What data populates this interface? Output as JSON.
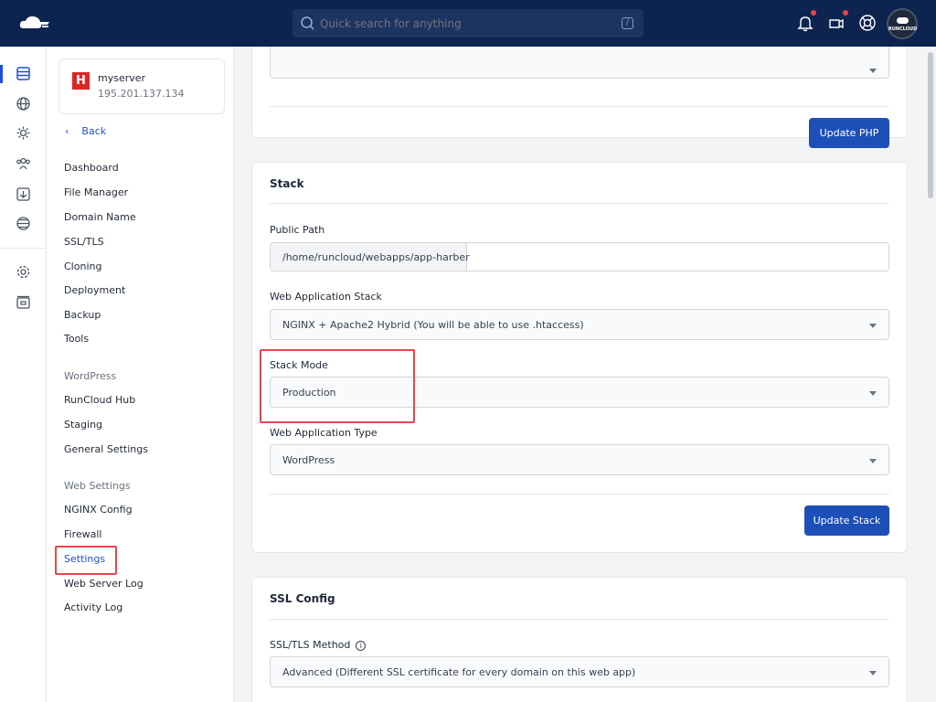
{
  "search": {
    "placeholder": "Quick search for anything",
    "shortcut": "/"
  },
  "avatar": {
    "label": "RUNCLOUD"
  },
  "server": {
    "name": "myserver",
    "ip": "195.201.137.134"
  },
  "sidebar": {
    "back_label": "Back",
    "items": [
      "Dashboard",
      "File Manager",
      "Domain Name",
      "SSL/TLS",
      "Cloning",
      "Deployment",
      "Backup",
      "Tools"
    ],
    "wordpress_heading": "WordPress",
    "wordpress_items": [
      "RunCloud Hub",
      "Staging",
      "General Settings"
    ],
    "web_settings_heading": "Web Settings",
    "web_settings_items": [
      "NGINX Config",
      "Firewall",
      "Settings",
      "Web Server Log",
      "Activity Log"
    ]
  },
  "php_card": {
    "update_button": "Update PHP"
  },
  "stack_card": {
    "title": "Stack",
    "public_path_label": "Public Path",
    "public_path_prefix": "/home/runcloud/webapps/app-harber",
    "public_path_value": "",
    "web_app_stack_label": "Web Application Stack",
    "web_app_stack_value": "NGINX + Apache2 Hybrid (You will be able to use .htaccess)",
    "stack_mode_label": "Stack Mode",
    "stack_mode_value": "Production",
    "web_app_type_label": "Web Application Type",
    "web_app_type_value": "WordPress",
    "update_button": "Update Stack"
  },
  "ssl_card": {
    "title": "SSL Config",
    "method_label": "SSL/TLS Method",
    "method_value": "Advanced (Different SSL certificate for every domain on this web app)"
  },
  "colors": {
    "topbar": "#0d2350",
    "accent": "#1d4fb8",
    "highlight": "#e5484d"
  }
}
